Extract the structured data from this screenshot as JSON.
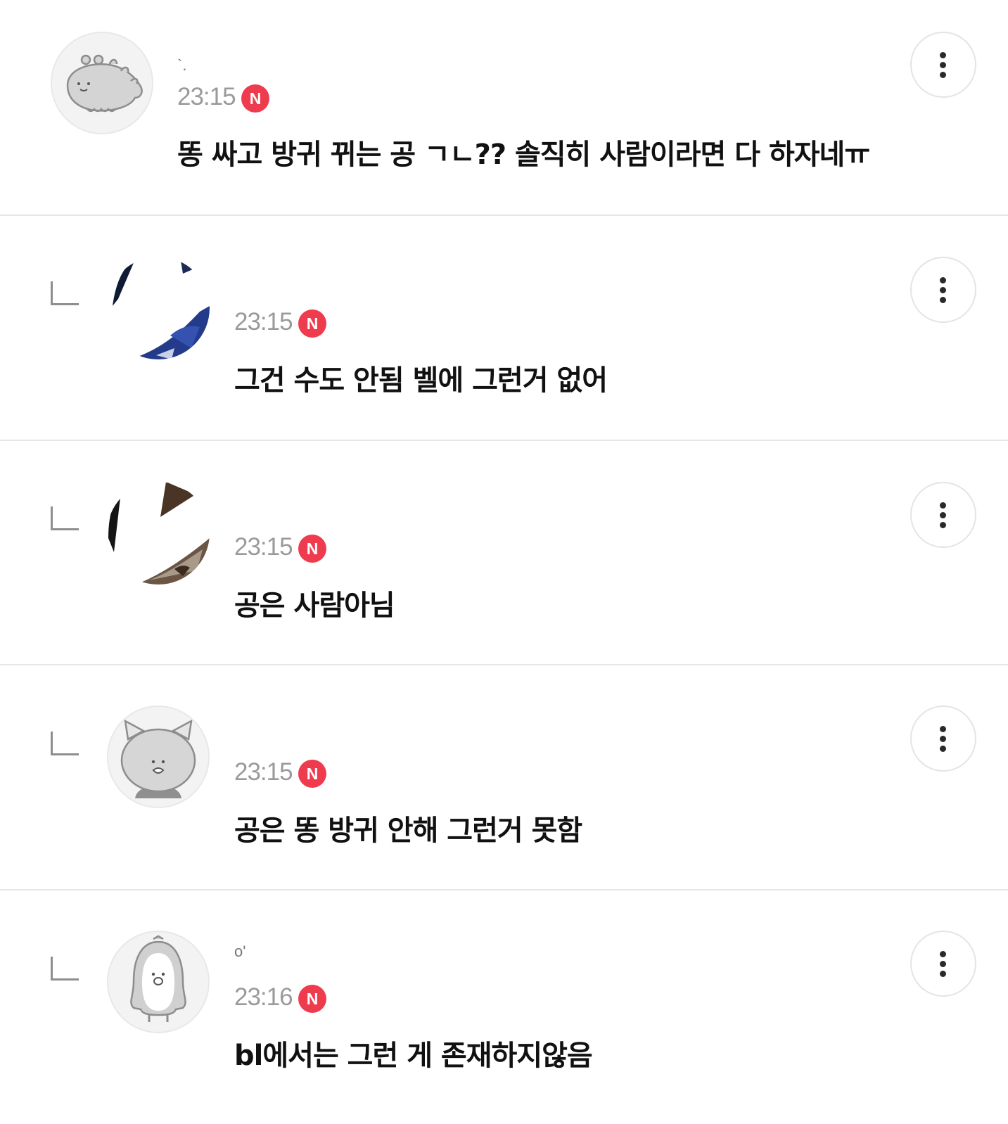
{
  "comments": [
    {
      "author": "`.",
      "time": "23:15",
      "badge": "N",
      "text": "똥 싸고 방귀 뀌는 공 ㄱㄴ?? 솔직히 사람이라면 다 하자네ㅠ",
      "is_reply": false,
      "avatar": "dinosaur-avatar-icon"
    },
    {
      "author": "",
      "time": "23:15",
      "badge": "N",
      "text": "그건 수도 안됨 벨에 그런거 없어",
      "is_reply": true,
      "avatar": "photo"
    },
    {
      "author": "",
      "time": "23:15",
      "badge": "N",
      "text": "공은 사람아님",
      "is_reply": true,
      "avatar": "photo"
    },
    {
      "author": "",
      "time": "23:15",
      "badge": "N",
      "text": "공은 똥 방귀 안해 그런거 못함",
      "is_reply": true,
      "avatar": "cat-avatar-icon"
    },
    {
      "author": "o'",
      "time": "23:16",
      "badge": "N",
      "text": "bl에서는 그런 게 존재하지않음",
      "is_reply": true,
      "avatar": "penguin-avatar-icon"
    }
  ],
  "colors": {
    "badge": "#ef3b4e",
    "time": "#9a9a9a",
    "text": "#111111",
    "divider": "#e6e6e6"
  },
  "icons": {
    "more": "more-vertical-icon",
    "reply": "reply-arrow-icon"
  }
}
